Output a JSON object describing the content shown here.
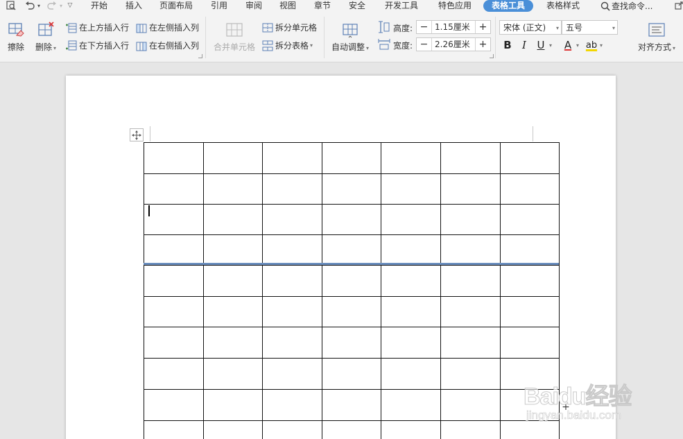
{
  "menubar": {
    "items": [
      {
        "label": "开始"
      },
      {
        "label": "插入"
      },
      {
        "label": "页面布局"
      },
      {
        "label": "引用"
      },
      {
        "label": "审阅"
      },
      {
        "label": "视图"
      },
      {
        "label": "章节"
      },
      {
        "label": "安全"
      },
      {
        "label": "开发工具"
      },
      {
        "label": "特色应用"
      },
      {
        "label": "表格工具",
        "active": true
      },
      {
        "label": "表格样式"
      }
    ],
    "search_label": "查找命令...",
    "accent_color": "#4a8fd8"
  },
  "ribbon": {
    "erase_label": "擦除",
    "delete_label": "删除",
    "insert_above_label": "在上方插入行",
    "insert_below_label": "在下方插入行",
    "insert_left_label": "在左侧插入列",
    "insert_right_label": "在右侧插入列",
    "merge_cells_label": "合并单元格",
    "split_cells_label": "拆分单元格",
    "split_table_label": "拆分表格",
    "autofit_label": "自动调整",
    "height_label": "高度:",
    "height_value": "1.15厘米",
    "width_label": "宽度:",
    "width_value": "2.26厘米",
    "font_name": "宋体 (正文)",
    "font_size": "五号",
    "bold_label": "B",
    "italic_label": "I",
    "underline_label": "U",
    "font_color_label": "A",
    "highlight_label": "ab",
    "align_label": "对齐方式"
  },
  "document": {
    "table": {
      "rows": 10,
      "cols": 7,
      "selected_border_color": "#6b8fbf"
    }
  },
  "watermark": {
    "brand": "Baidu经验",
    "url": "jingyan.baidu.com"
  }
}
